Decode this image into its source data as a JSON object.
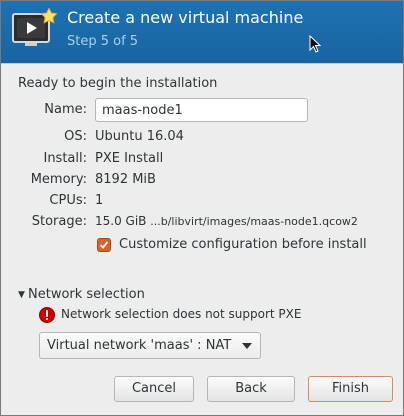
{
  "header": {
    "title": "Create a new virtual machine",
    "step": "Step 5 of 5",
    "icon": "virtual-machine-monitor-icon",
    "accent_color": "#1b6cac"
  },
  "ready_text": "Ready to begin the installation",
  "fields": {
    "name_label": "Name:",
    "name_value": "maas-node1",
    "os_label": "OS:",
    "os_value": "Ubuntu 16.04",
    "install_label": "Install:",
    "install_value": "PXE Install",
    "memory_label": "Memory:",
    "memory_value": "8192 MiB",
    "cpus_label": "CPUs:",
    "cpus_value": "1",
    "storage_label": "Storage:",
    "storage_value_size": "15.0 GiB",
    "storage_value_path": "...b/libvirt/images/maas-node1.qcow2"
  },
  "customize_checkbox": {
    "label": "Customize configuration before install",
    "checked": true
  },
  "network": {
    "expander_label": "Network selection",
    "expanded": true,
    "warning_text": "Network selection does not support PXE",
    "selected_option": "Virtual network 'maas' : NAT"
  },
  "buttons": {
    "cancel": "Cancel",
    "back": "Back",
    "finish": "Finish"
  }
}
